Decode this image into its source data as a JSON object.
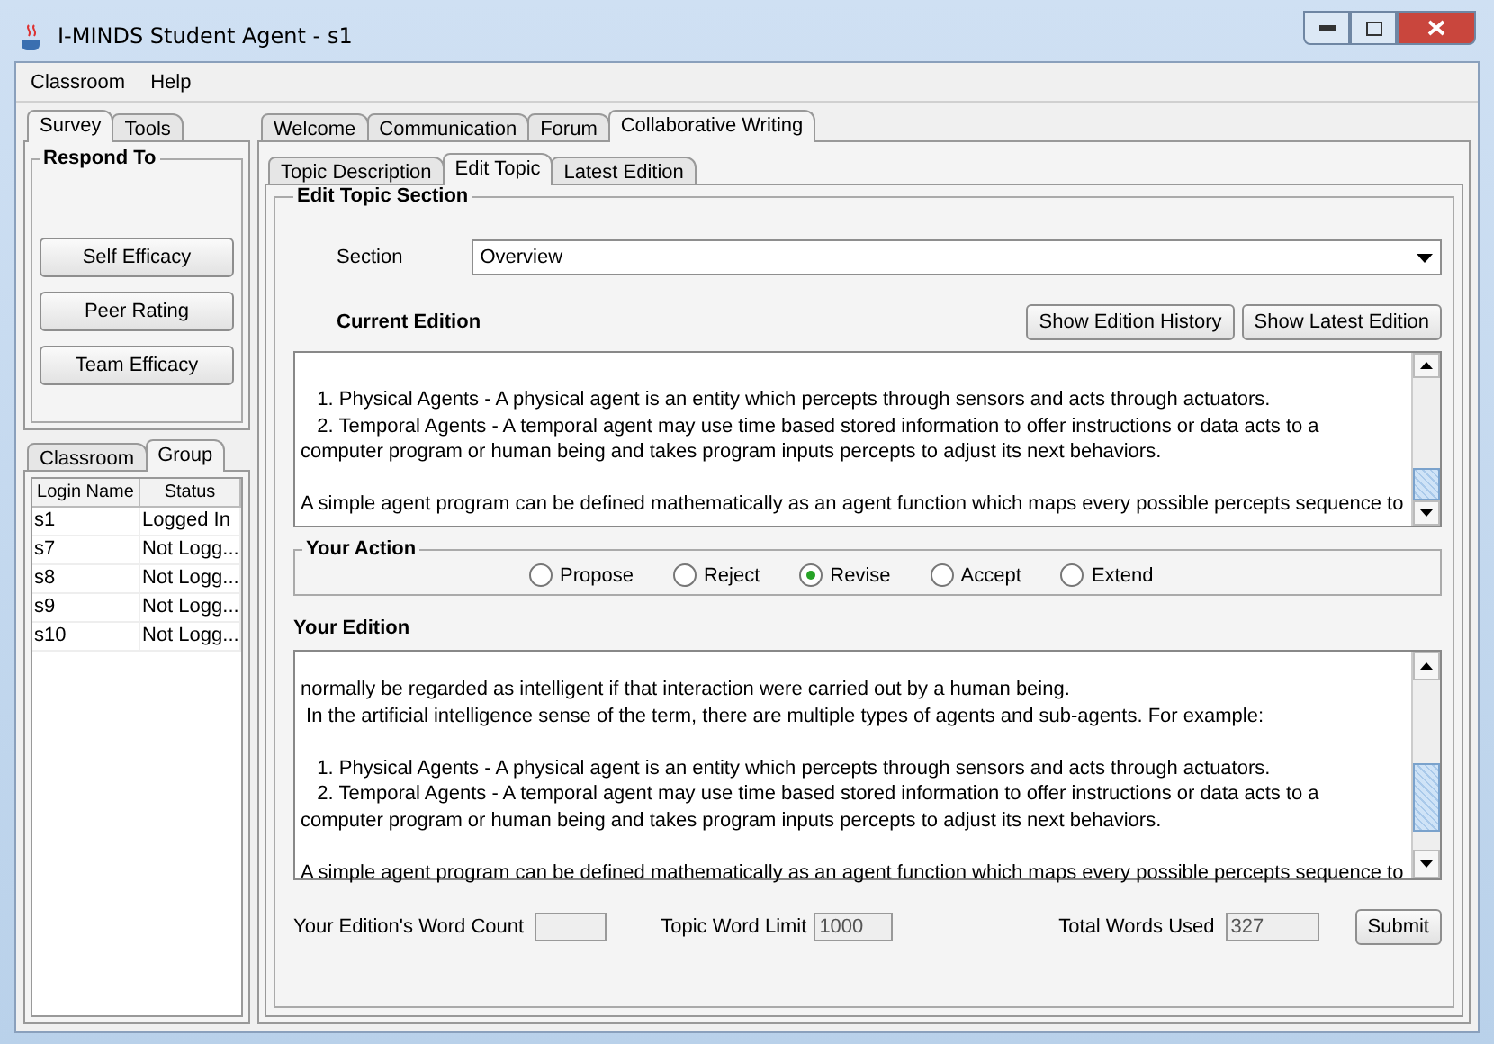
{
  "window": {
    "title": "I-MINDS Student Agent - s1"
  },
  "menu": [
    "Classroom",
    "Help"
  ],
  "left_tabs": [
    {
      "label": "Survey",
      "selected": true
    },
    {
      "label": "Tools",
      "selected": false
    }
  ],
  "respond_to": {
    "title": "Respond To",
    "buttons": [
      "Self Efficacy",
      "Peer Rating",
      "Team Efficacy"
    ]
  },
  "group_tabs": [
    {
      "label": "Classroom",
      "selected": false
    },
    {
      "label": "Group",
      "selected": true
    }
  ],
  "group_table": {
    "columns": [
      "Login Name",
      "Status"
    ],
    "rows": [
      [
        "s1",
        "Logged In"
      ],
      [
        "s7",
        "Not Logg..."
      ],
      [
        "s8",
        "Not Logg..."
      ],
      [
        "s9",
        "Not Logg..."
      ],
      [
        "s10",
        "Not Logg..."
      ]
    ]
  },
  "main_tabs": [
    {
      "label": "Welcome",
      "selected": false
    },
    {
      "label": "Communication",
      "selected": false
    },
    {
      "label": "Forum",
      "selected": false
    },
    {
      "label": "Collaborative Writing",
      "selected": true
    }
  ],
  "sub_tabs": [
    {
      "label": "Topic Description",
      "selected": false
    },
    {
      "label": "Edit Topic",
      "selected": true
    },
    {
      "label": "Latest Edition",
      "selected": false
    }
  ],
  "edit_section": {
    "title": "Edit Topic Section",
    "section_label": "Section",
    "section_value": "Overview",
    "current_edition": {
      "heading": "Current Edition",
      "buttons": [
        "Show Edition History",
        "Show Latest Edition"
      ],
      "paragraphs": [
        [
          "   1. Physical Agents - A physical agent is an entity which percepts through sensors and acts through actuators.",
          "   2. Temporal Agents - A temporal agent may use time based stored information to offer instructions or data acts to a",
          "computer program or human being and takes program inputs percepts to adjust its next behaviors."
        ],
        [
          "A simple agent program can be defined mathematically as an agent function which maps every possible percepts sequence to"
        ]
      ]
    },
    "your_action": {
      "title": "Your Action",
      "options": [
        {
          "label": "Propose",
          "selected": false
        },
        {
          "label": "Reject",
          "selected": false
        },
        {
          "label": "Revise",
          "selected": true
        },
        {
          "label": "Accept",
          "selected": false
        },
        {
          "label": "Extend",
          "selected": false
        }
      ]
    },
    "your_edition": {
      "heading": "Your Edition",
      "paragraphs": [
        [
          "normally be regarded as intelligent if that interaction were carried out by a human being.",
          " In the artificial intelligence sense of the term, there are multiple types of agents and sub-agents. For example:"
        ],
        [
          "   1. Physical Agents - A physical agent is an entity which percepts through sensors and acts through actuators.",
          "   2. Temporal Agents - A temporal agent may use time based stored information to offer instructions or data acts to a",
          "computer program or human being and takes program inputs percepts to adjust its next behaviors."
        ],
        [
          "A simple agent program can be defined mathematically as an agent function which maps every possible percepts sequence to"
        ]
      ]
    },
    "footer": {
      "word_count_label": "Your Edition's Word Count",
      "word_limit_label": "Topic Word Limit",
      "word_limit": "1000",
      "total_label": "Total Words Used",
      "total": "327",
      "submit": "Submit"
    }
  }
}
